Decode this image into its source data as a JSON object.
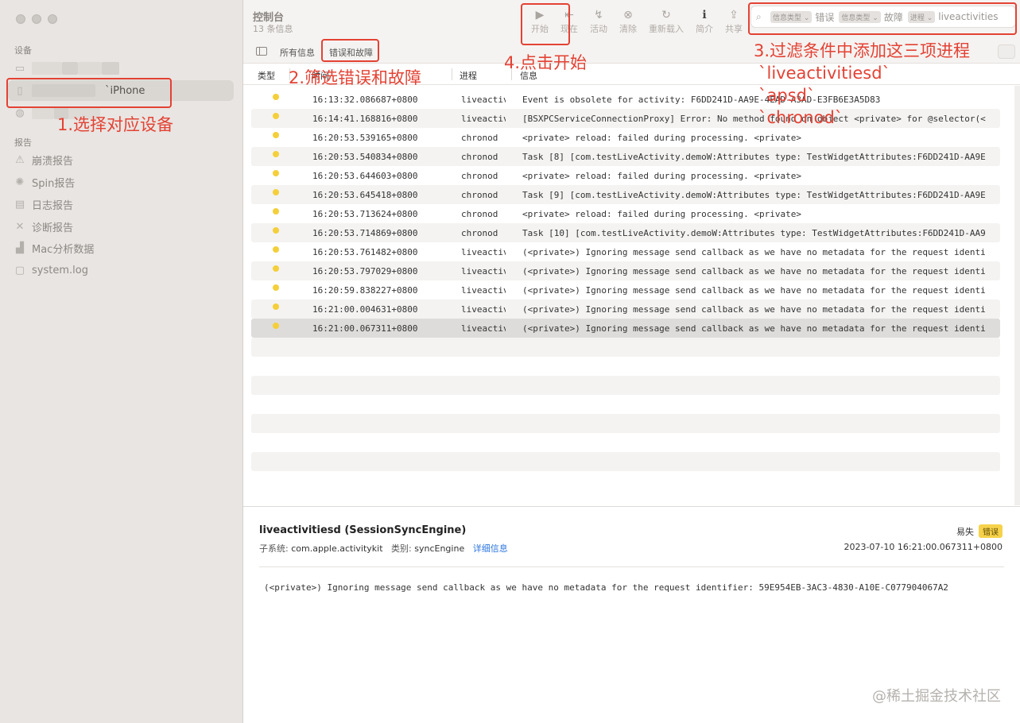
{
  "sidebar": {
    "devices_heading": "设备",
    "selected_device_suffix": "`iPhone",
    "reports_heading": "报告",
    "reports": [
      {
        "label": "崩溃报告",
        "icon": "warning-triangle-icon"
      },
      {
        "label": "Spin报告",
        "icon": "spin-icon"
      },
      {
        "label": "日志报告",
        "icon": "document-icon"
      },
      {
        "label": "诊断报告",
        "icon": "tools-icon"
      },
      {
        "label": "Mac分析数据",
        "icon": "chart-icon"
      },
      {
        "label": "system.log",
        "icon": "file-icon"
      }
    ]
  },
  "toolbar": {
    "title": "控制台",
    "subtitle": "13 条信息",
    "buttons": [
      {
        "label": "开始",
        "glyph": "▶"
      },
      {
        "label": "现在",
        "glyph": "⇤"
      },
      {
        "label": "活动",
        "glyph": "↯"
      },
      {
        "label": "清除",
        "glyph": "⊗"
      },
      {
        "label": "重新载入",
        "glyph": "↻"
      },
      {
        "label": "简介",
        "glyph": "ℹ"
      },
      {
        "label": "共享",
        "glyph": "⇪"
      }
    ],
    "search_tokens": [
      {
        "type": "信息类型 ⌄",
        "value": "错误"
      },
      {
        "type": "信息类型 ⌄",
        "value": "故障"
      },
      {
        "type": "进程 ⌄",
        "value": "liveactivities"
      }
    ]
  },
  "filterbar": {
    "all_messages": "所有信息",
    "errors_and_faults": "错误和故障"
  },
  "table": {
    "columns": {
      "type": "类型",
      "time": "时间",
      "process": "进程",
      "message": "信息"
    },
    "rows": [
      {
        "time": "16:13:32.086687+0800",
        "process": "liveactivitiesd",
        "message": "Event is obsolete for activity: F6DD241D-AA9E-4EAD-A3AD-E3FB6E3A5D83"
      },
      {
        "time": "16:14:41.168816+0800",
        "process": "liveactivitiesd",
        "message": "[BSXPCServiceConnectionProxy] Error: No method found on object <private> for @selector(<"
      },
      {
        "time": "16:20:53.539165+0800",
        "process": "chronod",
        "message": "<private> reload: failed during processing.  <private>"
      },
      {
        "time": "16:20:53.540834+0800",
        "process": "chronod",
        "message": "Task [8] [com.testLiveActivity.demoW:Attributes type: TestWidgetAttributes:F6DD241D-AA9E"
      },
      {
        "time": "16:20:53.644603+0800",
        "process": "chronod",
        "message": "<private> reload: failed during processing.  <private>"
      },
      {
        "time": "16:20:53.645418+0800",
        "process": "chronod",
        "message": "Task [9] [com.testLiveActivity.demoW:Attributes type: TestWidgetAttributes:F6DD241D-AA9E"
      },
      {
        "time": "16:20:53.713624+0800",
        "process": "chronod",
        "message": "<private> reload: failed during processing.  <private>"
      },
      {
        "time": "16:20:53.714869+0800",
        "process": "chronod",
        "message": "Task [10] [com.testLiveActivity.demoW:Attributes type: TestWidgetAttributes:F6DD241D-AA9"
      },
      {
        "time": "16:20:53.761482+0800",
        "process": "liveactivitiesd",
        "message": "(<private>) Ignoring message send callback as we have no metadata for the request identi"
      },
      {
        "time": "16:20:53.797029+0800",
        "process": "liveactivitiesd",
        "message": "(<private>) Ignoring message send callback as we have no metadata for the request identi"
      },
      {
        "time": "16:20:59.838227+0800",
        "process": "liveactivitiesd",
        "message": "(<private>) Ignoring message send callback as we have no metadata for the request identi"
      },
      {
        "time": "16:21:00.004631+0800",
        "process": "liveactivitiesd",
        "message": "(<private>) Ignoring message send callback as we have no metadata for the request identi"
      },
      {
        "time": "16:21:00.067311+0800",
        "process": "liveactivitiesd",
        "message": "(<private>) Ignoring message send callback as we have no metadata for the request identi"
      }
    ],
    "dot_color": "#f4cf3a"
  },
  "detail": {
    "title": "liveactivitiesd (SessionSyncEngine)",
    "subsystem_label": "子系统:",
    "subsystem": "com.apple.activitykit",
    "category_label": "类别:",
    "category": "syncEngine",
    "details_link": "详细信息",
    "volatile": "易失",
    "badge": "错误",
    "timestamp": "2023-07-10 16:21:00.067311+0800",
    "message": "(<private>) Ignoring message send callback as we have no metadata for the request identifier: 59E954EB-3AC3-4830-A10E-C077904067A2"
  },
  "annotations": {
    "step1": "1.选择对应设备",
    "step2": "2.筛选错误和故障",
    "step3": "3.过滤条件中添加这三项进程",
    "step3_lines": [
      "`liveactivitiesd`",
      "`apsd`",
      "`chronod`"
    ],
    "step4": "4.点击开始",
    "color": "#e34234"
  },
  "watermark": "@稀土掘金技术社区"
}
